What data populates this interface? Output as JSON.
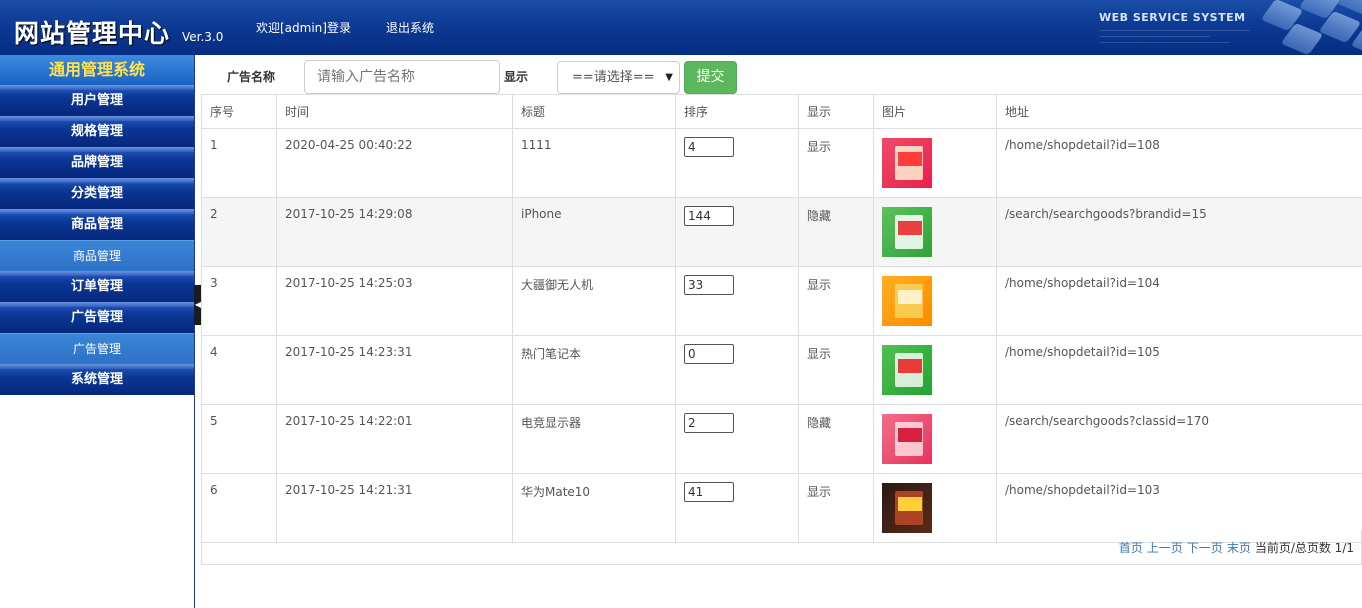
{
  "header": {
    "title": "网站管理中心",
    "version": "Ver.3.0",
    "welcome": "欢迎[admin]登录",
    "logout": "退出系统",
    "tagline": "WEB SERVICE SYSTEM"
  },
  "sidebar": {
    "title": "通用管理系统",
    "items": [
      {
        "label": "用户管理",
        "type": "menu"
      },
      {
        "label": "规格管理",
        "type": "menu"
      },
      {
        "label": "品牌管理",
        "type": "menu"
      },
      {
        "label": "分类管理",
        "type": "menu"
      },
      {
        "label": "商品管理",
        "type": "menu"
      },
      {
        "label": "商品管理",
        "type": "sub"
      },
      {
        "label": "订单管理",
        "type": "menu"
      },
      {
        "label": "广告管理",
        "type": "menu"
      },
      {
        "label": "广告管理",
        "type": "sub"
      },
      {
        "label": "系统管理",
        "type": "menu"
      }
    ]
  },
  "filter": {
    "name_label": "广告名称",
    "name_placeholder": "请输入广告名称",
    "display_label": "显示",
    "display_selected": "==请选择==",
    "submit_label": "提交"
  },
  "table": {
    "headers": [
      "序号",
      "时间",
      "标题",
      "排序",
      "显示",
      "图片",
      "地址"
    ],
    "rows": [
      {
        "id": "1",
        "time": "2020-04-25 00:40:22",
        "title": "1111",
        "order": "4",
        "display": "显示",
        "image": "red-pink-banner",
        "url": "/home/shopdetail?id=108"
      },
      {
        "id": "2",
        "time": "2017-10-25 14:29:08",
        "title": "iPhone",
        "order": "144",
        "display": "隐藏",
        "image": "green-banner",
        "url": "/search/searchgoods?brandid=15"
      },
      {
        "id": "3",
        "time": "2017-10-25 14:25:03",
        "title": "大疆御无人机",
        "order": "33",
        "display": "显示",
        "image": "orange-banner",
        "url": "/home/shopdetail?id=104"
      },
      {
        "id": "4",
        "time": "2017-10-25 14:23:31",
        "title": "热门笔记本",
        "order": "0",
        "display": "显示",
        "image": "green-banner-2",
        "url": "/home/shopdetail?id=105"
      },
      {
        "id": "5",
        "time": "2017-10-25 14:22:01",
        "title": "电竞显示器",
        "order": "2",
        "display": "隐藏",
        "image": "pink-banner",
        "url": "/search/searchgoods?classid=170"
      },
      {
        "id": "6",
        "time": "2017-10-25 14:21:31",
        "title": "华为Mate10",
        "order": "41",
        "display": "显示",
        "image": "dark-food-banner",
        "url": "/home/shopdetail?id=103"
      }
    ]
  },
  "pager": {
    "first": "首页",
    "prev": "上一页",
    "next": "下一页",
    "last": "末页",
    "status": "当前页/总页数 1/1"
  },
  "colors": {
    "header_blue": "#0d3a93",
    "side_title_yellow": "#ffe34a",
    "submit_green": "#5cb85c",
    "link_blue": "#337ab7"
  }
}
